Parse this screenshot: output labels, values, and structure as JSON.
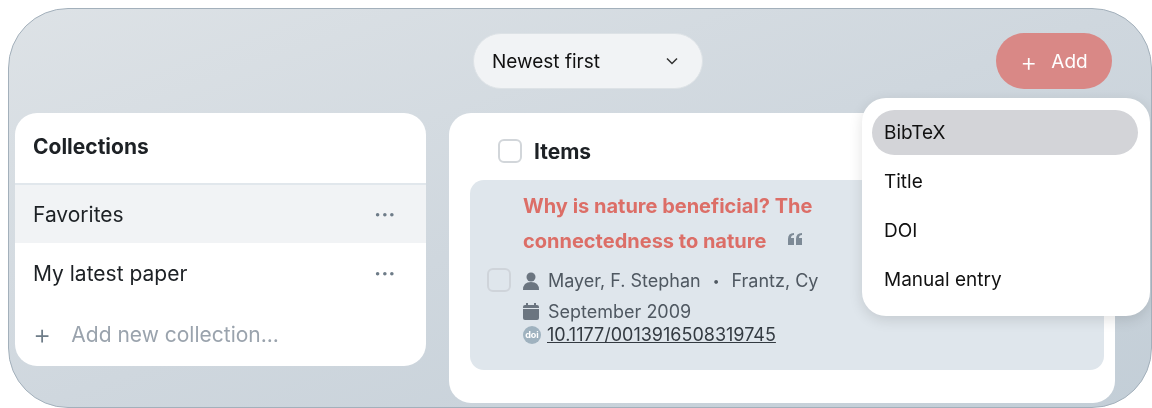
{
  "toolbar": {
    "sort": {
      "label": "Newest first"
    },
    "add_button": {
      "icon": "+",
      "label": "Add"
    }
  },
  "collections": {
    "title": "Collections",
    "items": [
      {
        "name": "Favorites",
        "selected": true,
        "more": "•••"
      },
      {
        "name": "My latest paper",
        "selected": false,
        "more": "•••"
      }
    ],
    "add": {
      "icon": "+",
      "placeholder": "Add new collection..."
    }
  },
  "items": {
    "title": "Items",
    "checked": false,
    "list": [
      {
        "checked": false,
        "title_lines": [
          "Why is nature beneficial? The",
          "connectedness to nature"
        ],
        "authors": [
          "Mayer, F. Stephan",
          "Frantz, Cy"
        ],
        "separator": "•",
        "date": "September 2009",
        "doi_badge": "doi",
        "doi": "10.1177/0013916508319745"
      }
    ]
  },
  "add_menu": {
    "items": [
      {
        "label": "BibTeX",
        "selected": true
      },
      {
        "label": "Title",
        "selected": false
      },
      {
        "label": "DOI",
        "selected": false
      },
      {
        "label": "Manual entry",
        "selected": false
      }
    ]
  }
}
